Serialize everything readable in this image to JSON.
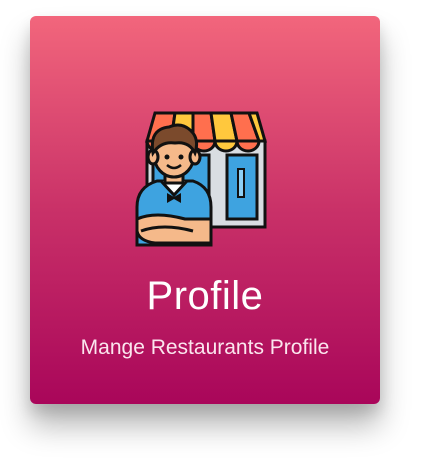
{
  "card": {
    "title": "Profile",
    "subtitle": "Mange Restaurants Profile",
    "icon": "restaurant-owner-icon",
    "gradient_top": "#f2667c",
    "gradient_bottom": "#a9065a"
  }
}
